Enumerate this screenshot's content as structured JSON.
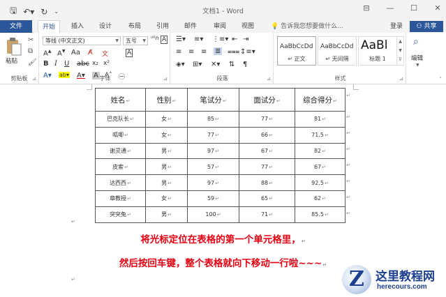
{
  "window": {
    "title": "文档1 - Word"
  },
  "tabs": {
    "file": "文件",
    "items": [
      "开始",
      "插入",
      "设计",
      "布局",
      "引用",
      "邮件",
      "审阅",
      "视图"
    ],
    "active": "开始",
    "tell_me": "告诉我您想要做什么...",
    "login": "登录",
    "share": "共享"
  },
  "ribbon": {
    "clipboard": {
      "paste": "粘贴",
      "label": "剪贴板"
    },
    "font": {
      "font_name": "等线 (中文正文)",
      "font_size": "五号",
      "label": "字体"
    },
    "paragraph": {
      "label": "段落"
    },
    "styles": {
      "label": "样式",
      "items": [
        {
          "preview": "AaBbCcDd",
          "name": "正文"
        },
        {
          "preview": "AaBbCcDd",
          "name": "无间隔"
        },
        {
          "preview": "AaBl",
          "name": "标题 1"
        }
      ]
    },
    "editing": {
      "label": "编辑"
    }
  },
  "table": {
    "headers": [
      "姓名",
      "性别",
      "笔试分",
      "面试分",
      "综合得分"
    ],
    "rows": [
      [
        "巴克队长",
        "女",
        "85",
        "77",
        "81"
      ],
      [
        "呱唧",
        "女",
        "77",
        "66",
        "71.5"
      ],
      [
        "谢灵通",
        "男",
        "97",
        "67",
        "82"
      ],
      [
        "皮索",
        "男",
        "57",
        "77",
        "67"
      ],
      [
        "达西西",
        "男",
        "97",
        "88",
        "92.5"
      ],
      [
        "章教授",
        "女",
        "59",
        "65",
        "62"
      ],
      [
        "突突兔",
        "男",
        "100",
        "71",
        "85.5"
      ]
    ]
  },
  "instructions": {
    "line1": "将光标定位在表格的第一个单元格里，",
    "line2": "然后按回车键，整个表格就向下移动一行啦~~~"
  },
  "watermark": {
    "title": "这里教程网",
    "url": "herecours.com"
  }
}
